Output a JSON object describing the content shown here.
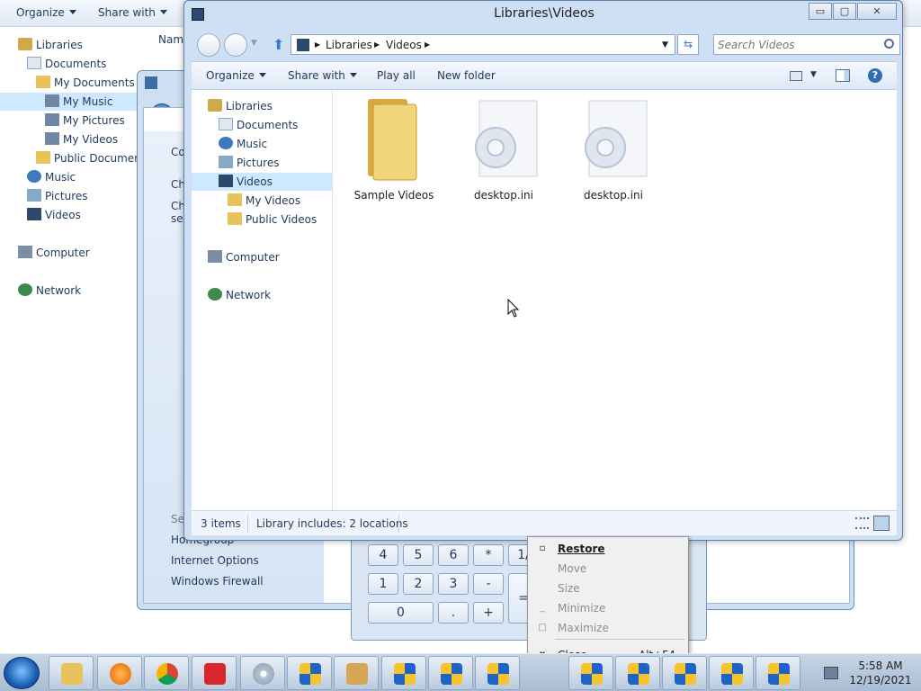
{
  "bg_explorer": {
    "toolbar": {
      "organize": "Organize",
      "share_with": "Share with"
    },
    "column_header": "Nam",
    "nav": [
      {
        "label": "Libraries",
        "icon": "libraries-icon"
      },
      {
        "label": "Documents",
        "icon": "documents-icon"
      },
      {
        "label": "My Documents",
        "icon": "folder-icon"
      },
      {
        "label": "My Music",
        "icon": "music-folder-icon"
      },
      {
        "label": "My Pictures",
        "icon": "pictures-folder-icon"
      },
      {
        "label": "My Videos",
        "icon": "videos-folder-icon"
      },
      {
        "label": "Public Documents",
        "icon": "folder-icon"
      },
      {
        "label": "Music",
        "icon": "music-icon"
      },
      {
        "label": "Pictures",
        "icon": "pictures-icon"
      },
      {
        "label": "Videos",
        "icon": "videos-icon"
      },
      {
        "label": "Computer",
        "icon": "computer-icon"
      },
      {
        "label": "Network",
        "icon": "network-icon"
      }
    ]
  },
  "control_panel": {
    "partial_texts": [
      "Co",
      "Ch",
      "Ch",
      "set"
    ],
    "see_also_partial": "Se",
    "homegroup_partial": "Homegroup",
    "links": [
      "Internet Options",
      "Windows Firewall"
    ]
  },
  "calculator": {
    "keys": [
      "4",
      "5",
      "6",
      "*",
      "1/",
      "1",
      "2",
      "3",
      "-",
      "=",
      "0",
      ".",
      "+"
    ]
  },
  "main_window": {
    "title": "Libraries\\Videos",
    "controls": {
      "minimize": "▭",
      "maximize": "▢",
      "close": "✕"
    },
    "breadcrumb": [
      "Libraries",
      "Videos"
    ],
    "search_placeholder": "Search Videos",
    "toolbar": {
      "organize": "Organize",
      "share_with": "Share with",
      "play_all": "Play all",
      "new_folder": "New folder",
      "help": "?"
    },
    "nav": [
      {
        "label": "Libraries",
        "icon": "libraries-icon"
      },
      {
        "label": "Documents",
        "icon": "documents-icon"
      },
      {
        "label": "Music",
        "icon": "music-icon"
      },
      {
        "label": "Pictures",
        "icon": "pictures-icon"
      },
      {
        "label": "Videos",
        "icon": "videos-icon"
      },
      {
        "label": "My Videos",
        "icon": "folder-icon"
      },
      {
        "label": "Public Videos",
        "icon": "folder-icon"
      },
      {
        "label": "Computer",
        "icon": "computer-icon"
      },
      {
        "label": "Network",
        "icon": "network-icon"
      }
    ],
    "files": [
      {
        "name": "Sample Videos",
        "icon": "folder-icon"
      },
      {
        "name": "desktop.ini",
        "icon": "settings-file-icon"
      },
      {
        "name": "desktop.ini",
        "icon": "settings-file-icon"
      }
    ],
    "status": {
      "item_count": "3 items",
      "library_info": "Library includes: 2 locations"
    }
  },
  "context_menu": {
    "items": [
      {
        "label": "Restore",
        "mark": "▫",
        "shortcut": ""
      },
      {
        "label": "Move",
        "mark": "",
        "shortcut": ""
      },
      {
        "label": "Size",
        "mark": "",
        "shortcut": ""
      },
      {
        "label": "Minimize",
        "mark": "_",
        "shortcut": ""
      },
      {
        "label": "Maximize",
        "mark": "□",
        "shortcut": ""
      },
      {
        "label": "Close",
        "mark": "x",
        "shortcut": "Alt+F4"
      }
    ]
  },
  "taskbar": {
    "clock_time": "5:58 AM",
    "clock_date": "12/19/2021",
    "pinned": [
      "windows-explorer-icon",
      "firefox-icon",
      "chrome-icon",
      "security-app-icon",
      "dvd-icon",
      "shield-icon",
      "calculator-icon",
      "shield-icon",
      "shield-icon",
      "shield-icon",
      "shield-icon",
      "shield-icon",
      "shield-icon",
      "shield-icon",
      "shield-icon"
    ]
  },
  "colors": {
    "accent": "#1e395b",
    "selection": "#cde8ff",
    "folder": "#e8c25a"
  }
}
